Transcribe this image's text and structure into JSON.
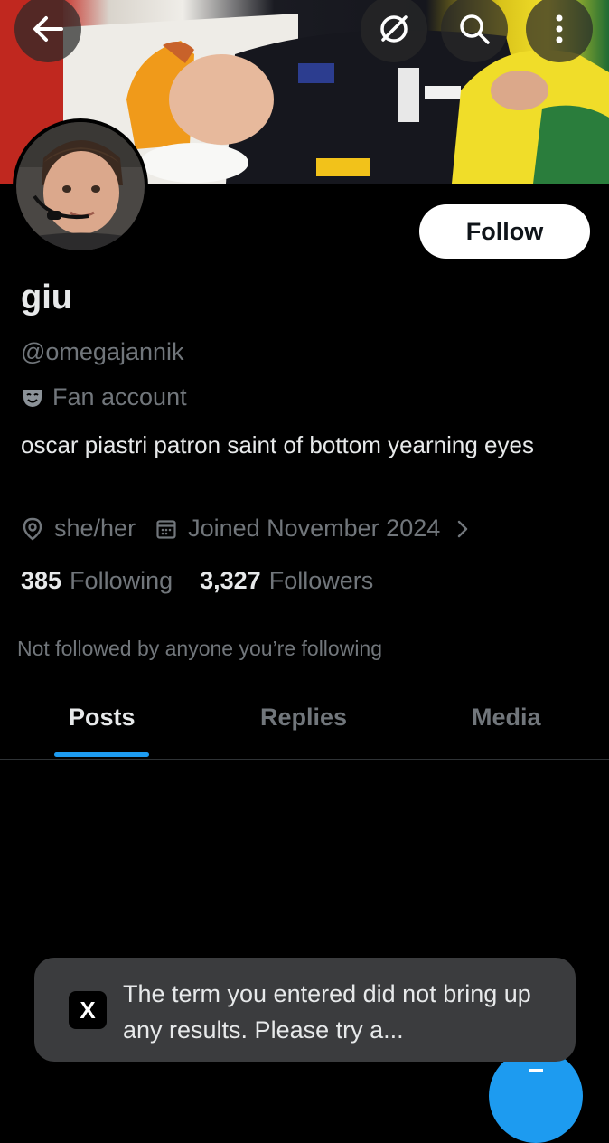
{
  "header": {
    "back_icon": "arrow-left-icon",
    "grok_icon": "slash-circle-icon",
    "search_icon": "search-icon",
    "more_icon": "more-vertical-icon"
  },
  "profile": {
    "display_name": "giu",
    "handle": "@omegajannik",
    "label": "Fan account",
    "bio": "oscar piastri patron saint of bottom yearning eyes",
    "pronouns": "she/her",
    "joined": "Joined November 2024",
    "following_count": "385",
    "following_label": "Following",
    "followers_count": "3,327",
    "followers_label": "Followers",
    "not_followed_text": "Not followed by anyone you’re following"
  },
  "actions": {
    "follow_label": "Follow"
  },
  "tabs": [
    {
      "label": "Posts",
      "active": true
    },
    {
      "label": "Replies",
      "active": false
    },
    {
      "label": "Media",
      "active": false
    }
  ],
  "toast": {
    "logo": "X",
    "message": "The term you entered did not bring up any results. Please try a..."
  },
  "colors": {
    "accent": "#1d9bf0",
    "background": "#000000",
    "muted_text": "#71767b",
    "primary_text": "#e7e9ea"
  }
}
